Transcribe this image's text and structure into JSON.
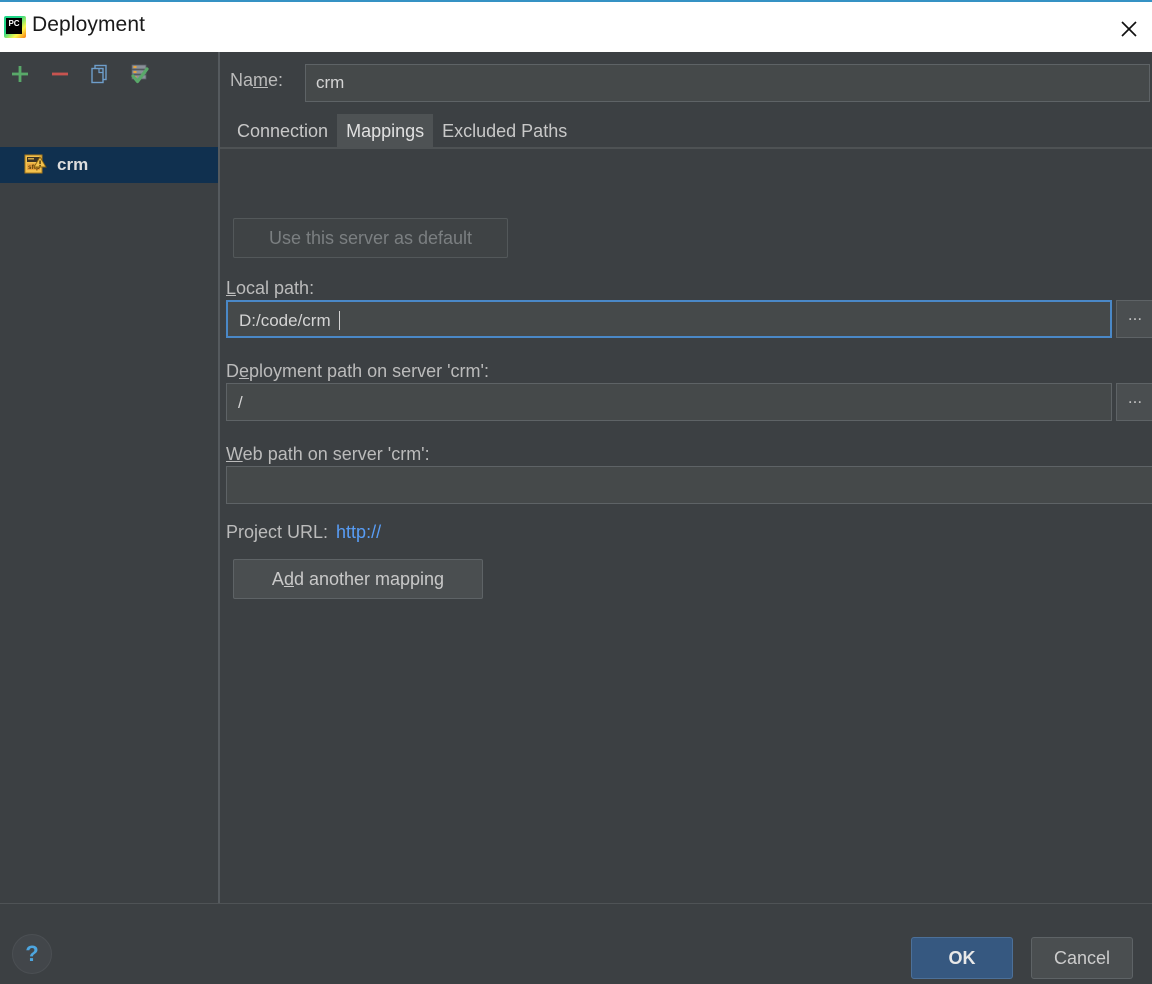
{
  "window": {
    "title": "Deployment",
    "app_icon": "pycharm-icon",
    "close_icon": "close-icon",
    "accent_color": "#3592c4"
  },
  "sidebar": {
    "toolbar": [
      {
        "name": "add-server-button",
        "icon": "plus-icon",
        "color": "#59a869"
      },
      {
        "name": "remove-server-button",
        "icon": "minus-icon",
        "color": "#c75450"
      },
      {
        "name": "copy-server-button",
        "icon": "copy-icon",
        "color": "#6e9ecb"
      },
      {
        "name": "set-default-server-button",
        "icon": "server-check-icon",
        "color": "#59a869"
      }
    ],
    "servers": [
      {
        "label": "crm",
        "icon": "sftp-server-icon",
        "selected": true
      }
    ]
  },
  "main": {
    "name_label": "Name:",
    "name_label_mnemonic": "m",
    "name_value": "crm",
    "tabs": [
      {
        "label": "Connection",
        "active": false
      },
      {
        "label": "Mappings",
        "active": true
      },
      {
        "label": "Excluded Paths",
        "active": false
      }
    ],
    "use_default_button": {
      "label": "Use this server as default",
      "disabled": true
    },
    "fields": [
      {
        "label_pre": "L",
        "label_mnemonic": "o",
        "label_post": "cal path:",
        "label_full": "Local path:",
        "value": "D:/code/crm",
        "focused": true,
        "has_browse": true,
        "browse_label": "..."
      },
      {
        "label_pre": "D",
        "label_mnemonic": "e",
        "label_post": "ployment path on server 'crm':",
        "label_full": "Deployment path on server 'crm':",
        "value": "/",
        "focused": false,
        "has_browse": true,
        "browse_label": "..."
      },
      {
        "label_pre": "",
        "label_mnemonic": "W",
        "label_post": "eb path on server 'crm':",
        "label_full": "Web path on server 'crm':",
        "value": "",
        "focused": false,
        "has_browse": false,
        "browse_label": ""
      }
    ],
    "project_url_label": "Project URL:",
    "project_url_value": "http://",
    "add_mapping_button": {
      "label_pre": "A",
      "label_mnemonic": "d",
      "label_post": "d another mapping",
      "label_full": "Add another mapping"
    }
  },
  "footer": {
    "help_label": "?",
    "ok_label": "OK",
    "cancel_label": "Cancel"
  }
}
